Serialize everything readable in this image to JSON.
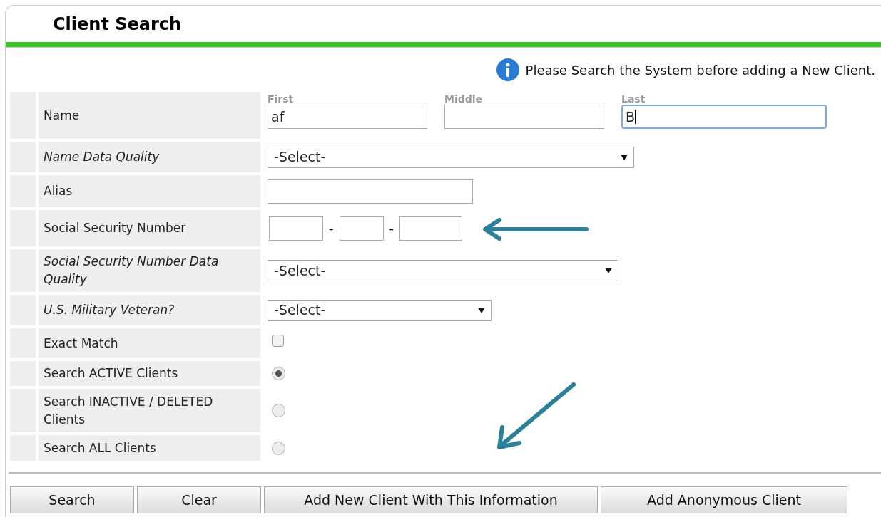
{
  "title": "Client Search",
  "notice": "Please Search the System before adding a New Client.",
  "rows": [
    {
      "kind": "name",
      "label": "Name",
      "italic": false,
      "fields": [
        {
          "caption": "First",
          "value": "af",
          "focused": false
        },
        {
          "caption": "Middle",
          "focused": false
        },
        {
          "caption": "Last",
          "value": "B",
          "focused": true
        }
      ]
    },
    {
      "kind": "select",
      "label": "Name Data Quality",
      "italic": true,
      "value": "-Select-"
    },
    {
      "kind": "text",
      "label": "Alias",
      "italic": false
    },
    {
      "kind": "ssn",
      "label": "Social Security Number",
      "italic": false,
      "separator": "-"
    },
    {
      "kind": "select",
      "label": "Social Security Number Data Quality",
      "italic": true,
      "value": "-Select-"
    },
    {
      "kind": "select",
      "label": "U.S. Military Veteran?",
      "italic": true,
      "value": "-Select-"
    },
    {
      "kind": "checkbox",
      "label": "Exact Match",
      "italic": false,
      "checked": false
    },
    {
      "kind": "radio",
      "label": "Search ACTIVE Clients",
      "italic": false,
      "selected": true
    },
    {
      "kind": "radio",
      "label": "Search INACTIVE / DELETED Clients",
      "italic": false,
      "selected": false
    },
    {
      "kind": "radio",
      "label": "Search ALL Clients",
      "italic": false,
      "selected": false
    }
  ],
  "buttons": [
    "Search",
    "Clear",
    "Add New Client With This Information",
    "Add Anonymous Client"
  ]
}
